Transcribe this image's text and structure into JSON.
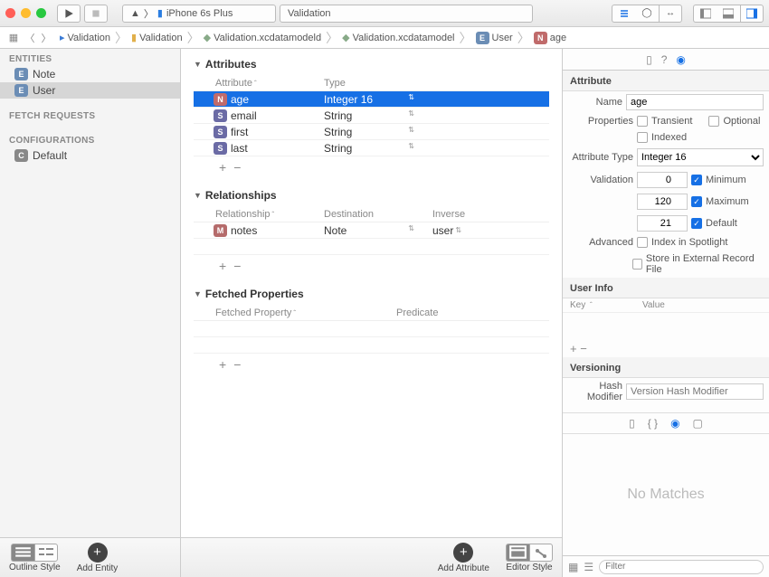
{
  "toolbar": {
    "scheme": "iPhone 6s Plus",
    "title": "Validation"
  },
  "breadcrumbs": [
    {
      "label": "Validation",
      "badge": "proj"
    },
    {
      "label": "Validation",
      "badge": "folder"
    },
    {
      "label": "Validation.xcdatamodeld",
      "badge": "modeld"
    },
    {
      "label": "Validation.xcdatamodel",
      "badge": "model"
    },
    {
      "label": "User",
      "badge": "E"
    },
    {
      "label": "age",
      "badge": "N"
    }
  ],
  "sidebar": {
    "entities_header": "ENTITIES",
    "entities": [
      {
        "name": "Note",
        "selected": false
      },
      {
        "name": "User",
        "selected": true
      }
    ],
    "fetch_header": "FETCH REQUESTS",
    "config_header": "CONFIGURATIONS",
    "configs": [
      {
        "name": "Default"
      }
    ]
  },
  "editor": {
    "attributes_header": "Attributes",
    "attr_col1": "Attribute",
    "attr_col2": "Type",
    "attributes": [
      {
        "name": "age",
        "type": "Integer 16",
        "badge": "N",
        "selected": true
      },
      {
        "name": "email",
        "type": "String",
        "badge": "S",
        "selected": false
      },
      {
        "name": "first",
        "type": "String",
        "badge": "S",
        "selected": false
      },
      {
        "name": "last",
        "type": "String",
        "badge": "S",
        "selected": false
      }
    ],
    "relationships_header": "Relationships",
    "rel_col1": "Relationship",
    "rel_col2": "Destination",
    "rel_col3": "Inverse",
    "relationships": [
      {
        "name": "notes",
        "destination": "Note",
        "inverse": "user",
        "badge": "M"
      }
    ],
    "fetched_header": "Fetched Properties",
    "fp_col1": "Fetched Property",
    "fp_col2": "Predicate"
  },
  "bottombar": {
    "outline_style": "Outline Style",
    "add_entity": "Add Entity",
    "add_attribute": "Add Attribute",
    "editor_style": "Editor Style"
  },
  "inspector": {
    "section_attr": "Attribute",
    "name_lbl": "Name",
    "name_val": "age",
    "properties_lbl": "Properties",
    "transient_lbl": "Transient",
    "transient": false,
    "optional_lbl": "Optional",
    "optional": false,
    "indexed_lbl": "Indexed",
    "indexed": false,
    "attrtype_lbl": "Attribute Type",
    "attrtype_val": "Integer 16",
    "validation_lbl": "Validation",
    "min_on": true,
    "min_val": "0",
    "min_lbl": "Minimum",
    "max_on": true,
    "max_val": "120",
    "max_lbl": "Maximum",
    "def_on": true,
    "def_val": "21",
    "def_lbl": "Default",
    "advanced_lbl": "Advanced",
    "spotlight_lbl": "Index in Spotlight",
    "spotlight": false,
    "external_lbl": "Store in External Record File",
    "external": false,
    "section_userinfo": "User Info",
    "key_lbl": "Key",
    "value_lbl": "Value",
    "section_versioning": "Versioning",
    "hashmod_lbl": "Hash Modifier",
    "hashmod_ph": "Version Hash Modifier",
    "nomatches": "No Matches",
    "filter_ph": "Filter"
  }
}
